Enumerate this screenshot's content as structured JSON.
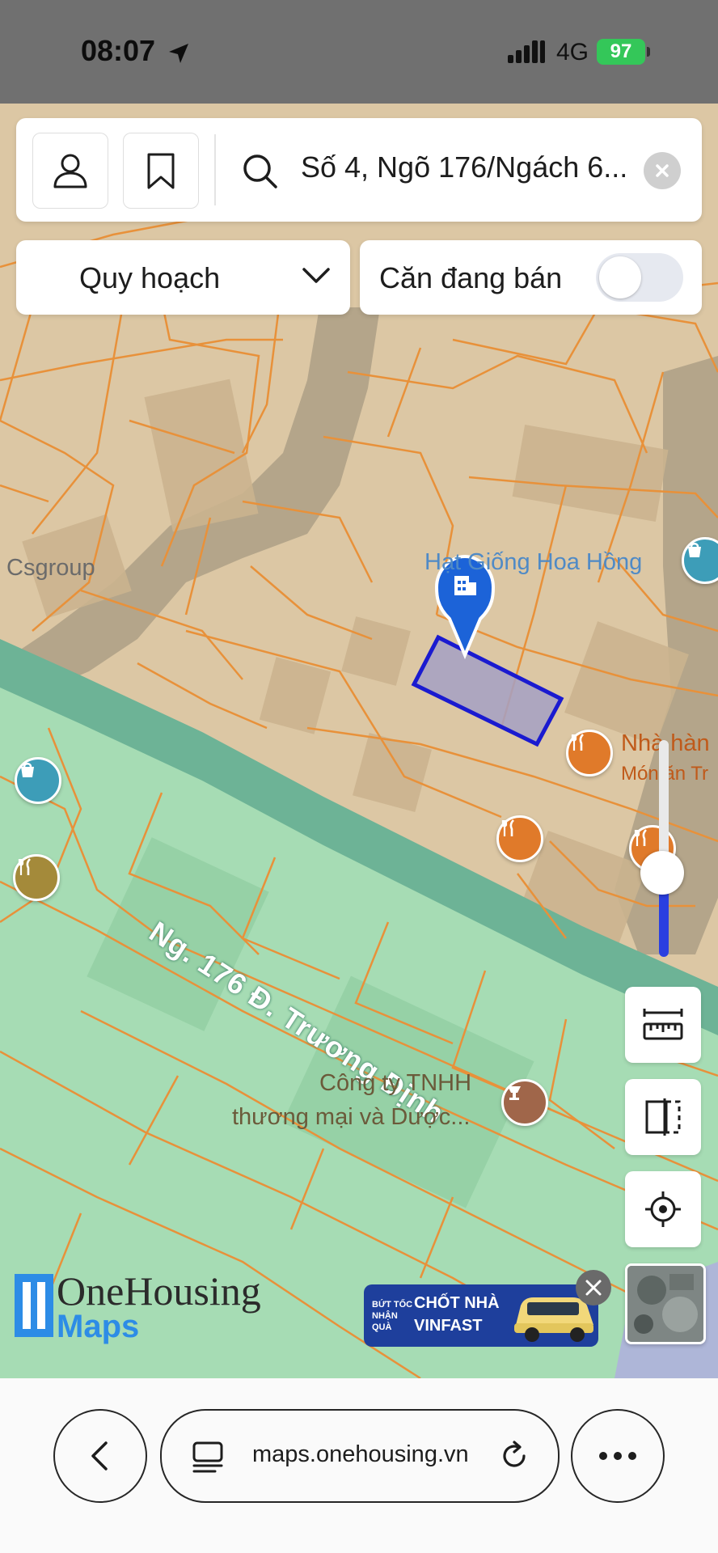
{
  "status_bar": {
    "time": "08:07",
    "network": "4G",
    "battery": "97"
  },
  "search": {
    "text": "Số 4, Ngõ 176/Ngách 6..."
  },
  "filters": {
    "dropdown_label": "Quy hoạch",
    "toggle_label": "Căn đang bán",
    "toggle_on": false
  },
  "map_labels": {
    "csgroup": "Csgroup",
    "seed_shop": "Hạt Giống Hoa Hồng",
    "restaurant": "Nhà hàn",
    "restaurant_sub": "Món ăn Tr",
    "road": "Ng. 176 Đ. Trương Định",
    "company_line1": "Công ty TNHH",
    "company_line2": "thương mại và Dược..."
  },
  "logo": {
    "line1": "OneHousing",
    "line2": "Maps"
  },
  "ad": {
    "small": "BỨT TỐC NHẬN QUÀ",
    "line1": "CHỐT NHÀ",
    "line2": "VINFAST"
  },
  "browser": {
    "url": "maps.onehousing.vn"
  },
  "colors": {
    "accent": "#2a3fe0",
    "parcel_line": "#e8913a",
    "green_zone": "#a6dcb4",
    "road": "#6db396",
    "selected": "#1a1ad0"
  },
  "icons": [
    "location-arrow-icon",
    "signal-icon",
    "user-icon",
    "bookmark-icon",
    "search-icon",
    "clear-icon",
    "chevron-down-icon",
    "ruler-icon",
    "split-view-icon",
    "locate-icon",
    "back-icon",
    "tabs-icon",
    "reload-icon",
    "more-icon"
  ]
}
